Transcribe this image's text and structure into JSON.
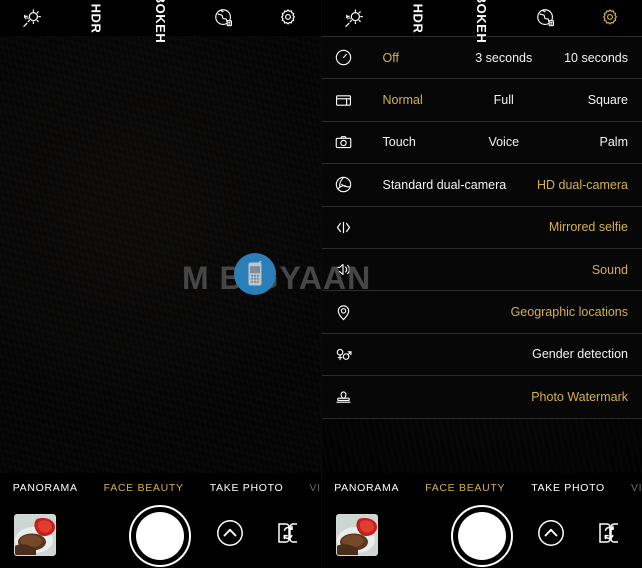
{
  "app": {
    "name": "Camera",
    "accent_gold": "#d4b04a",
    "text_white": "#ffffff",
    "background": "#000000"
  },
  "topbar": {
    "items": [
      {
        "id": "flash-auto",
        "icon": "flash-auto-icon",
        "label": "",
        "active": false
      },
      {
        "id": "hdr",
        "icon": "hdr-text",
        "label": "HDR",
        "active": false
      },
      {
        "id": "bokeh",
        "icon": "bokeh-text",
        "label": "BOKEH",
        "active": false
      },
      {
        "id": "filters",
        "icon": "filter-globe-icon",
        "label": "",
        "active": false
      },
      {
        "id": "settings",
        "icon": "gear-icon",
        "label": "",
        "active": false
      }
    ],
    "settings_active_right": true
  },
  "settings_menu": {
    "rows": [
      {
        "id": "timer",
        "icon": "timer-icon",
        "layout": "three",
        "options": [
          {
            "label": "Off",
            "selected": true
          },
          {
            "label": "3 seconds",
            "selected": false
          },
          {
            "label": "10 seconds",
            "selected": false
          }
        ]
      },
      {
        "id": "aspect-ratio",
        "icon": "aspect-ratio-icon",
        "layout": "three",
        "options": [
          {
            "label": "Normal",
            "selected": true
          },
          {
            "label": "Full",
            "selected": false
          },
          {
            "label": "Square",
            "selected": false
          }
        ]
      },
      {
        "id": "capture-mode",
        "icon": "camera-icon",
        "layout": "three",
        "options": [
          {
            "label": "Touch",
            "selected": false
          },
          {
            "label": "Voice",
            "selected": false
          },
          {
            "label": "Palm",
            "selected": false
          }
        ]
      },
      {
        "id": "dual-camera",
        "icon": "aperture-icon",
        "layout": "two",
        "options": [
          {
            "label": "Standard dual-camera",
            "selected": false
          },
          {
            "label": "HD dual-camera",
            "selected": true
          }
        ]
      },
      {
        "id": "mirrored-selfie",
        "icon": "mirror-icon",
        "layout": "one",
        "options": [
          {
            "label": "Mirrored selfie",
            "selected": true
          }
        ]
      },
      {
        "id": "sound",
        "icon": "speaker-icon",
        "layout": "one",
        "options": [
          {
            "label": "Sound",
            "selected": true
          }
        ]
      },
      {
        "id": "geographic-locations",
        "icon": "location-pin-icon",
        "layout": "one",
        "options": [
          {
            "label": "Geographic locations",
            "selected": true
          }
        ]
      },
      {
        "id": "gender-detection",
        "icon": "gender-icon",
        "layout": "one",
        "options": [
          {
            "label": "Gender detection",
            "selected": false
          }
        ]
      },
      {
        "id": "photo-watermark",
        "icon": "stamp-icon",
        "layout": "one",
        "options": [
          {
            "label": "Photo Watermark",
            "selected": true
          }
        ]
      }
    ]
  },
  "modes": {
    "items": [
      {
        "label": "PANORAMA",
        "active": false,
        "cut": false
      },
      {
        "label": "FACE BEAUTY",
        "active": true,
        "cut": false
      },
      {
        "label": "TAKE PHOTO",
        "active": false,
        "cut": false
      },
      {
        "label": "VI",
        "active": false,
        "cut": true
      }
    ]
  },
  "controls": {
    "thumbnail": "gallery-thumbnail",
    "shutter": "shutter-button",
    "expand": "chevron-up-icon",
    "switch_camera": "switch-camera-icon"
  },
  "watermark": {
    "text": "M BIGYAAN",
    "prefix": "M",
    "suffix": "BIGYAAN",
    "logo": "mobile-phone-logo"
  }
}
